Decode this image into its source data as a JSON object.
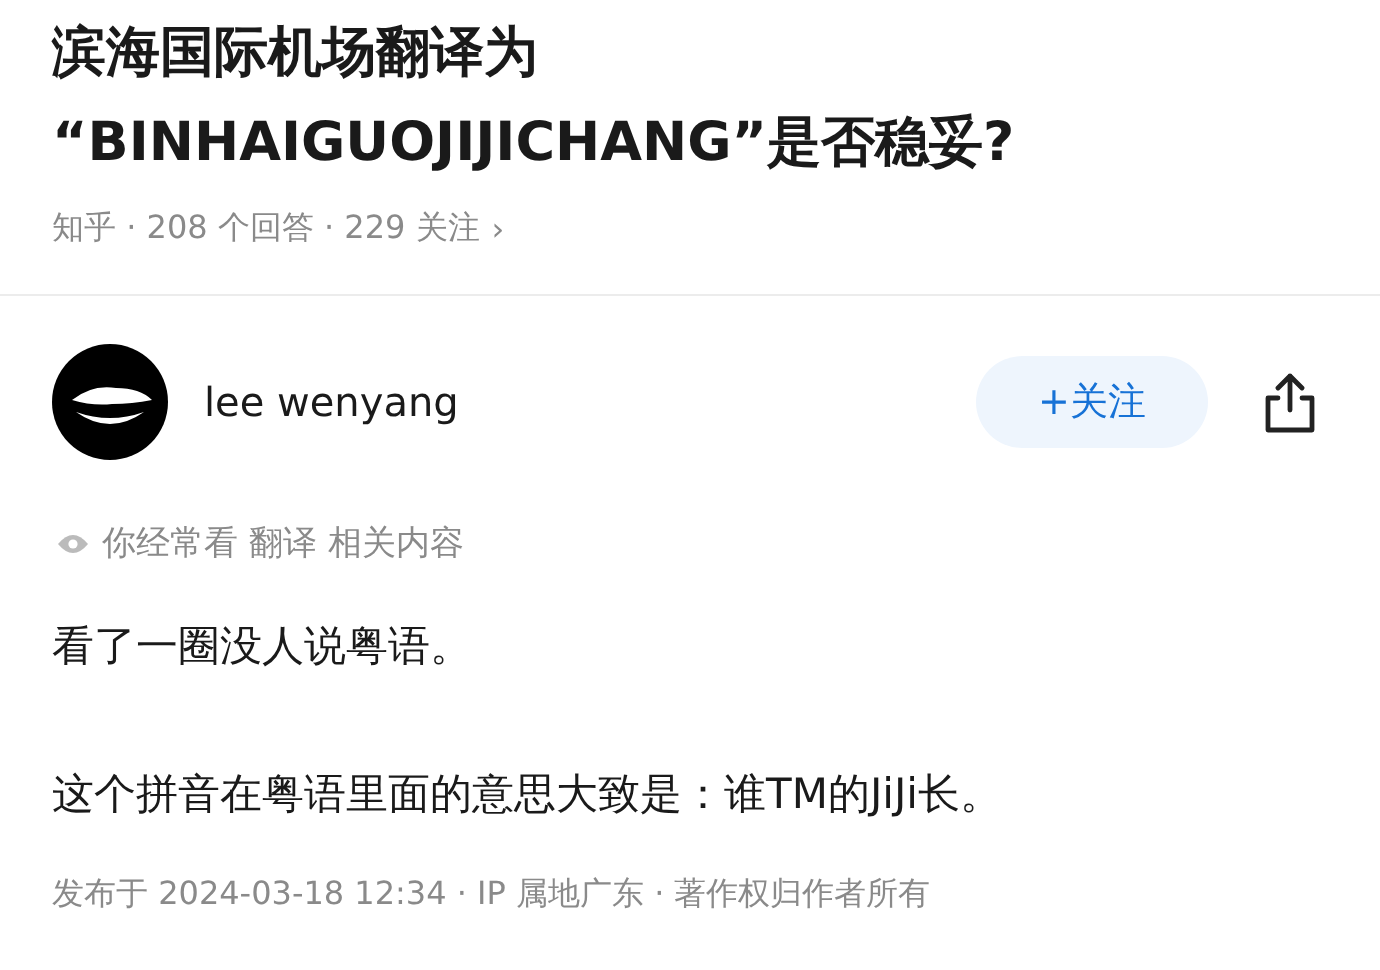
{
  "question": {
    "title_lines": [
      "滨海国际机场翻译为",
      "“BINHAIGUOJIJICHANG”是否稳妥?"
    ],
    "meta": "知乎 · 208 个回答 · 229 关注",
    "meta_arrow": "›"
  },
  "author": {
    "name": "lee wenyang",
    "follow_label": "+关注",
    "followed": false
  },
  "reason": "你经常看 翻译 相关内容",
  "paragraphs": [
    "看了一圈没人说粤语。",
    "这个拼音在粤语里面的意思大致是：谁TM的JiJi长。"
  ],
  "footer": "发布于 2024-03-18 12:34 · IP 属地广东 · 著作权归作者所有"
}
